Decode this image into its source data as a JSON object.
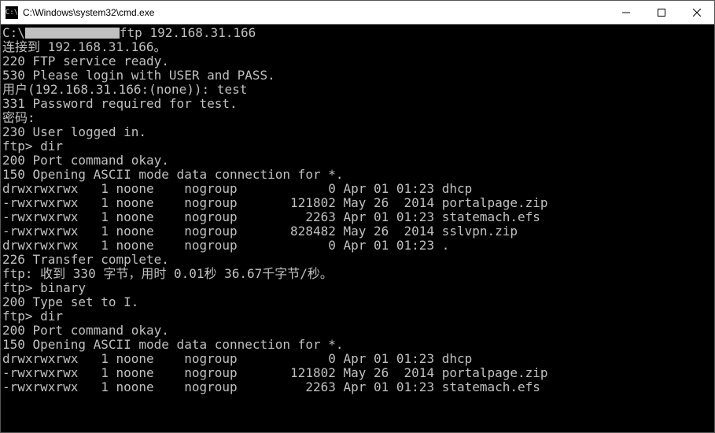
{
  "titlebar": {
    "icon_label": "C:\\",
    "title": "C:\\Windows\\system32\\cmd.exe"
  },
  "terminal": {
    "prompt_prefix": "C:\\",
    "command": "ftp 192.168.31.166",
    "lines": [
      "连接到 192.168.31.166。",
      "220 FTP service ready.",
      "530 Please login with USER and PASS.",
      "用户(192.168.31.166:(none)): test",
      "331 Password required for test.",
      "密码:",
      "230 User logged in.",
      "ftp> dir",
      "200 Port command okay.",
      "150 Opening ASCII mode data connection for *.",
      "drwxrwxrwx   1 noone    nogroup            0 Apr 01 01:23 dhcp",
      "-rwxrwxrwx   1 noone    nogroup       121802 May 26  2014 portalpage.zip",
      "-rwxrwxrwx   1 noone    nogroup         2263 Apr 01 01:23 statemach.efs",
      "-rwxrwxrwx   1 noone    nogroup       828482 May 26  2014 sslvpn.zip",
      "drwxrwxrwx   1 noone    nogroup            0 Apr 01 01:23 .",
      "226 Transfer complete.",
      "ftp: 收到 330 字节，用时 0.01秒 36.67千字节/秒。",
      "ftp> binary",
      "200 Type set to I.",
      "ftp> dir",
      "200 Port command okay.",
      "150 Opening ASCII mode data connection for *.",
      "drwxrwxrwx   1 noone    nogroup            0 Apr 01 01:23 dhcp",
      "-rwxrwxrwx   1 noone    nogroup       121802 May 26  2014 portalpage.zip",
      "-rwxrwxrwx   1 noone    nogroup         2263 Apr 01 01:23 statemach.efs"
    ]
  }
}
